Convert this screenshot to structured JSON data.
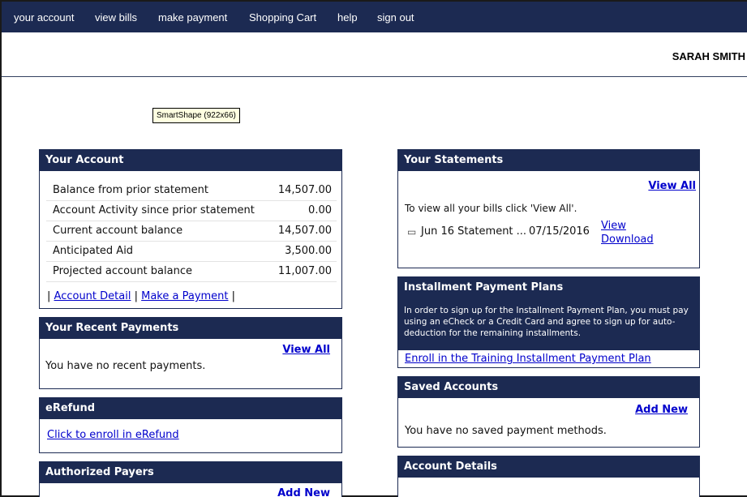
{
  "nav": {
    "items": [
      {
        "label": "your account"
      },
      {
        "label": "view bills"
      },
      {
        "label": "make payment"
      },
      {
        "label": "Shopping Cart"
      },
      {
        "label": "help"
      },
      {
        "label": "sign out"
      }
    ]
  },
  "user": {
    "name": "SARAH SMITH"
  },
  "tooltip": {
    "text": "SmartShape (922x66)"
  },
  "your_account": {
    "title": "Your Account",
    "rows": [
      {
        "label": "Balance from prior statement",
        "value": "14,507.00"
      },
      {
        "label": "Account Activity since prior statement",
        "value": "0.00"
      },
      {
        "label": "Current account balance",
        "value": "14,507.00"
      },
      {
        "label": "Anticipated Aid",
        "value": "3,500.00"
      },
      {
        "label": "Projected account balance",
        "value": "11,007.00"
      }
    ],
    "separator": "|",
    "account_detail_link": "Account Detail",
    "make_payment_link": "Make a Payment"
  },
  "recent_payments": {
    "title": "Your Recent Payments",
    "view_all": "View All",
    "message": "You have no recent payments."
  },
  "erefund": {
    "title": "eRefund",
    "enroll_link": "Click to enroll in eRefund"
  },
  "authorized_payers": {
    "title": "Authorized Payers",
    "add_new": "Add New"
  },
  "statements": {
    "title": "Your Statements",
    "view_all": "View All",
    "message": "To view all your bills click 'View All'.",
    "items": [
      {
        "icon": "document-icon",
        "name": "Jun 16 Statement ...",
        "date": "07/15/2016",
        "view": "View",
        "download": "Download"
      }
    ]
  },
  "installment": {
    "title": "Installment Payment Plans",
    "description": "In order to sign up for the Installment Payment Plan, you must pay using an eCheck or a Credit Card and agree to sign up for auto-deduction for the remaining installments.",
    "enroll_link": "Enroll in the Training Installment Payment Plan"
  },
  "saved_accounts": {
    "title": "Saved Accounts",
    "add_new": "Add New",
    "message": "You have no saved payment methods."
  },
  "account_details": {
    "title": "Account Details"
  },
  "colors": {
    "navy": "#1c2a52",
    "link": "#0000cc",
    "tooltip_bg": "#ffffe1"
  }
}
